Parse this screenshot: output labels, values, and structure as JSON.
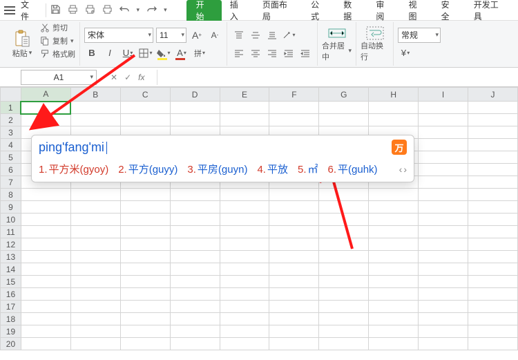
{
  "menu": {
    "file": "文件"
  },
  "tabs": [
    "开始",
    "插入",
    "页面布局",
    "公式",
    "数据",
    "审阅",
    "视图",
    "安全",
    "开发工具"
  ],
  "clipboard": {
    "paste": "粘贴",
    "cut": "剪切",
    "copy": "复制",
    "formatPainter": "格式刷"
  },
  "font": {
    "name": "宋体",
    "size": "11"
  },
  "merge": {
    "label": "合并居中"
  },
  "wrap": {
    "label": "自动换行"
  },
  "format": {
    "general": "常规"
  },
  "namebox": {
    "value": "A1"
  },
  "fx": {
    "label": "fx"
  },
  "columns": [
    "A",
    "B",
    "C",
    "D",
    "E",
    "F",
    "G",
    "H",
    "I",
    "J"
  ],
  "rows": [
    "1",
    "2",
    "3",
    "4",
    "5",
    "6",
    "7",
    "8",
    "9",
    "10",
    "11",
    "12",
    "13",
    "14",
    "15",
    "16",
    "17",
    "18",
    "19",
    "20"
  ],
  "ime": {
    "typed": "ping'fang'mi",
    "logo": "万",
    "candidates": [
      {
        "n": "1.",
        "t": "平方米(gyoy)"
      },
      {
        "n": "2.",
        "t": "平方(guyy)"
      },
      {
        "n": "3.",
        "t": "平房(guyn)"
      },
      {
        "n": "4.",
        "t": "平放"
      },
      {
        "n": "5.",
        "t": "㎡"
      },
      {
        "n": "6.",
        "t": "平(guhk)"
      }
    ],
    "nav_prev": "‹",
    "nav_next": "›"
  }
}
